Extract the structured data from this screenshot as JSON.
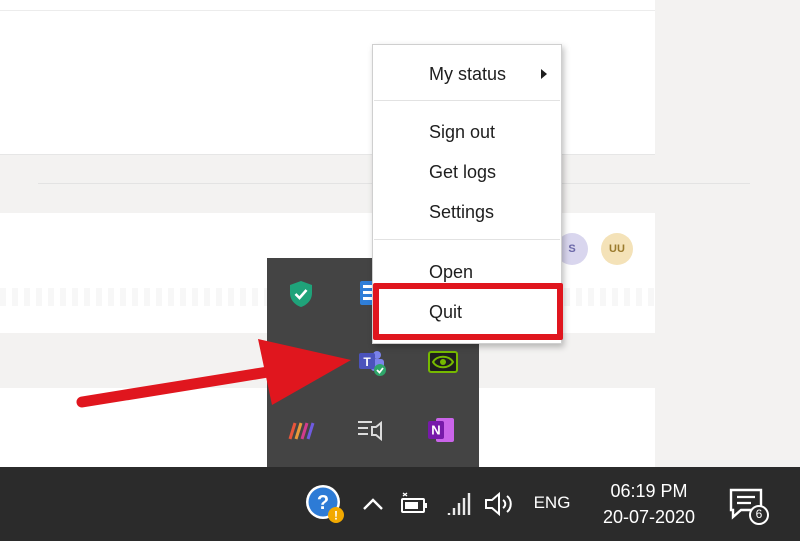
{
  "context_menu": {
    "items": [
      {
        "label": "My status",
        "has_submenu": true
      },
      {
        "label": "Sign out"
      },
      {
        "label": "Get logs"
      },
      {
        "label": "Settings"
      },
      {
        "label": "Open"
      },
      {
        "label": "Quit",
        "highlighted": true
      }
    ]
  },
  "background": {
    "avatars": [
      "S",
      "UU"
    ]
  },
  "tray_icons": [
    {
      "name": "security-shield-icon"
    },
    {
      "name": "network-drive-icon"
    },
    {
      "name": "shield-outline-icon"
    },
    {
      "name": "teams-icon"
    },
    {
      "name": "nvidia-icon"
    },
    {
      "name": "meter-icon"
    },
    {
      "name": "speaker-list-icon"
    },
    {
      "name": "onenote-icon"
    }
  ],
  "taskbar": {
    "language": "ENG",
    "time": "06:19 PM",
    "date": "20-07-2020",
    "notification_count": "6"
  },
  "colors": {
    "annotation_red": "#e0161e",
    "taskbar": "#2b2b2b",
    "tray_flyout": "#444444",
    "teams_purple": "#5b5fc7"
  }
}
